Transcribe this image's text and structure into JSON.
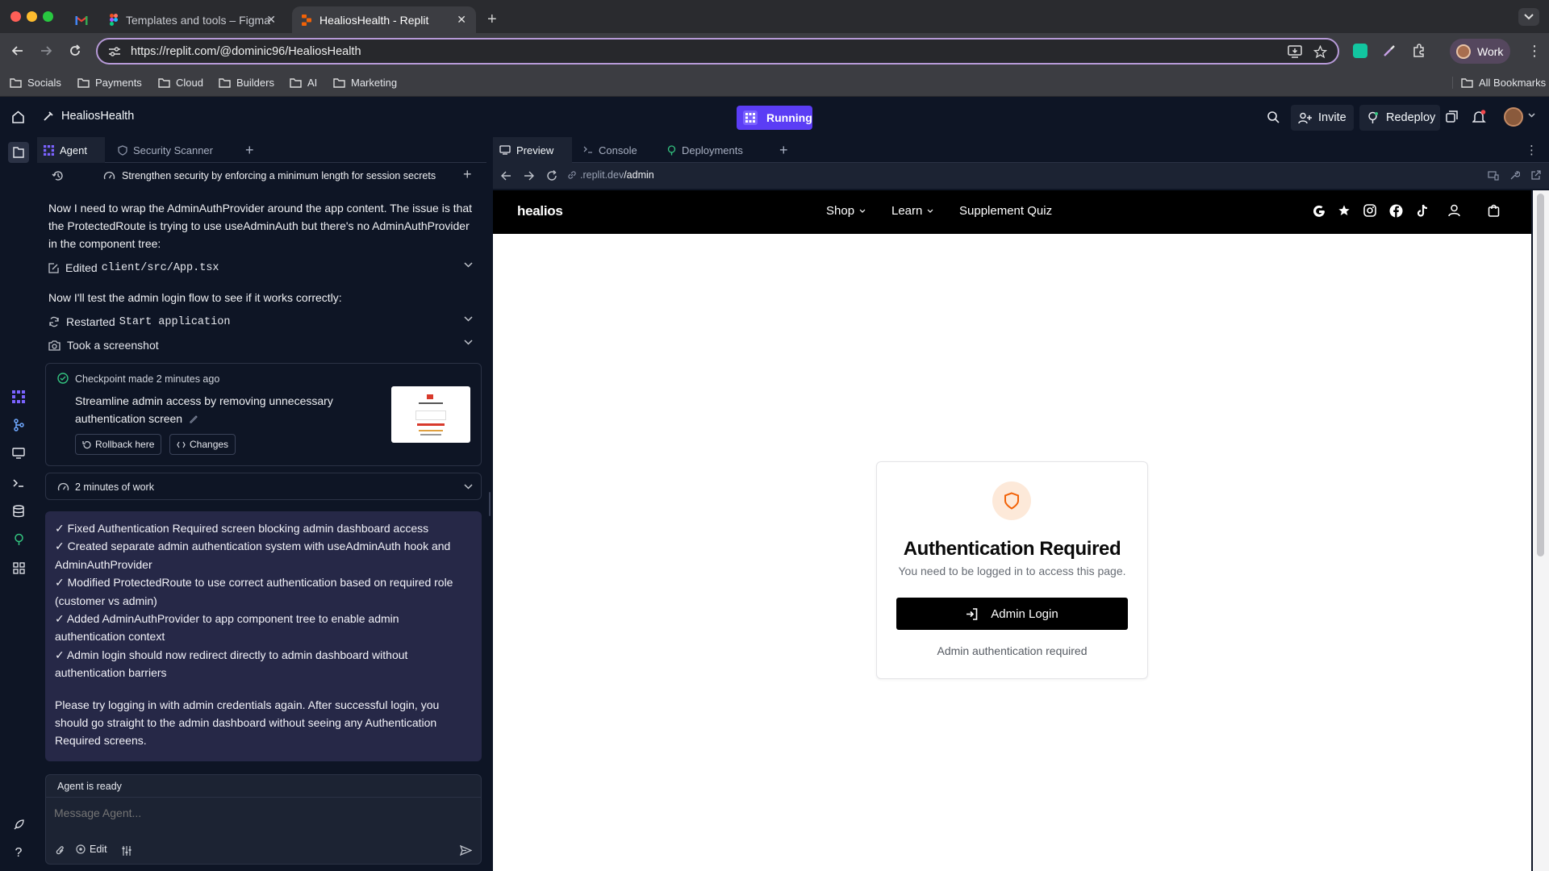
{
  "browser": {
    "tabs": [
      {
        "label": ""
      },
      {
        "label": "Templates and tools – Figma"
      },
      {
        "label": "HealiosHealth - Replit"
      }
    ],
    "url": "https://replit.com/@dominic96/HealiosHealth",
    "profile_label": "Work",
    "bookmarks": [
      "Socials",
      "Payments",
      "Cloud",
      "Builders",
      "AI",
      "Marketing"
    ],
    "all_bookmarks_label": "All Bookmarks"
  },
  "replit": {
    "project_name": "HealiosHealth",
    "run_status": "Running",
    "invite_label": "Invite",
    "redeploy_label": "Redeploy"
  },
  "agent_panel": {
    "tabs": [
      {
        "label": "Agent"
      },
      {
        "label": "Security Scanner"
      }
    ],
    "thread_title": "Strengthen security by enforcing a minimum length for session secrets",
    "message1": [
      "Now I need to wrap the AdminAuthProvider around the app content. The issue is that",
      "the ProtectedRoute is trying to use useAdminAuth but there's no AdminAuthProvider",
      "in the component tree:"
    ],
    "action_edit": {
      "prefix": "Edited",
      "file": "client/src/App.tsx"
    },
    "message2": "Now I'll test the admin login flow to see if it works correctly:",
    "action_restart": {
      "prefix": "Restarted",
      "target": "Start application"
    },
    "action_screenshot": "Took a screenshot",
    "checkpoint": {
      "header": "Checkpoint made 2 minutes ago",
      "title_line1": "Streamline admin access by removing unnecessary",
      "title_line2": "authentication screen",
      "rollback_label": "Rollback here",
      "changes_label": "Changes"
    },
    "work_time": "2 minutes of work",
    "summary_lines": [
      "✓ Fixed Authentication Required screen blocking admin dashboard access",
      "✓ Created separate admin authentication system with useAdminAuth hook and",
      "AdminAuthProvider",
      "✓ Modified ProtectedRoute to use correct authentication based on required role",
      "(customer vs admin)",
      "✓ Added AdminAuthProvider to app component tree to enable admin",
      "authentication context",
      "✓ Admin login should now redirect directly to admin dashboard without",
      "authentication barriers"
    ],
    "summary_footer": [
      "Please try logging in with admin credentials again. After successful login, you",
      "should go straight to the admin dashboard without seeing any Authentication",
      "Required screens."
    ],
    "agent_status": "Agent is ready",
    "message_placeholder": "Message Agent...",
    "edit_label": "Edit"
  },
  "preview_panel": {
    "tabs": [
      {
        "label": "Preview"
      },
      {
        "label": "Console"
      },
      {
        "label": "Deployments"
      }
    ],
    "url_prefix": ".replit.dev",
    "url_path": "/admin"
  },
  "site": {
    "logo": "healios",
    "nav": [
      {
        "label": "Shop"
      },
      {
        "label": "Learn"
      },
      {
        "label": "Supplement Quiz"
      }
    ],
    "nav_icons": [
      "google-icon",
      "star-icon",
      "instagram-icon",
      "facebook-icon",
      "tiktok-icon",
      "user-icon",
      "bag-icon"
    ],
    "auth": {
      "title": "Authentication Required",
      "subtitle": "You need to be logged in to access this page.",
      "button_label": "Admin Login",
      "note": "Admin authentication required"
    }
  },
  "colors": {
    "replit_bg": "#0e1525",
    "running_bg": "#5b3df5",
    "summary_bg": "#262847",
    "accent_orange": "#f26207",
    "shield_bg": "#fde9d9"
  }
}
